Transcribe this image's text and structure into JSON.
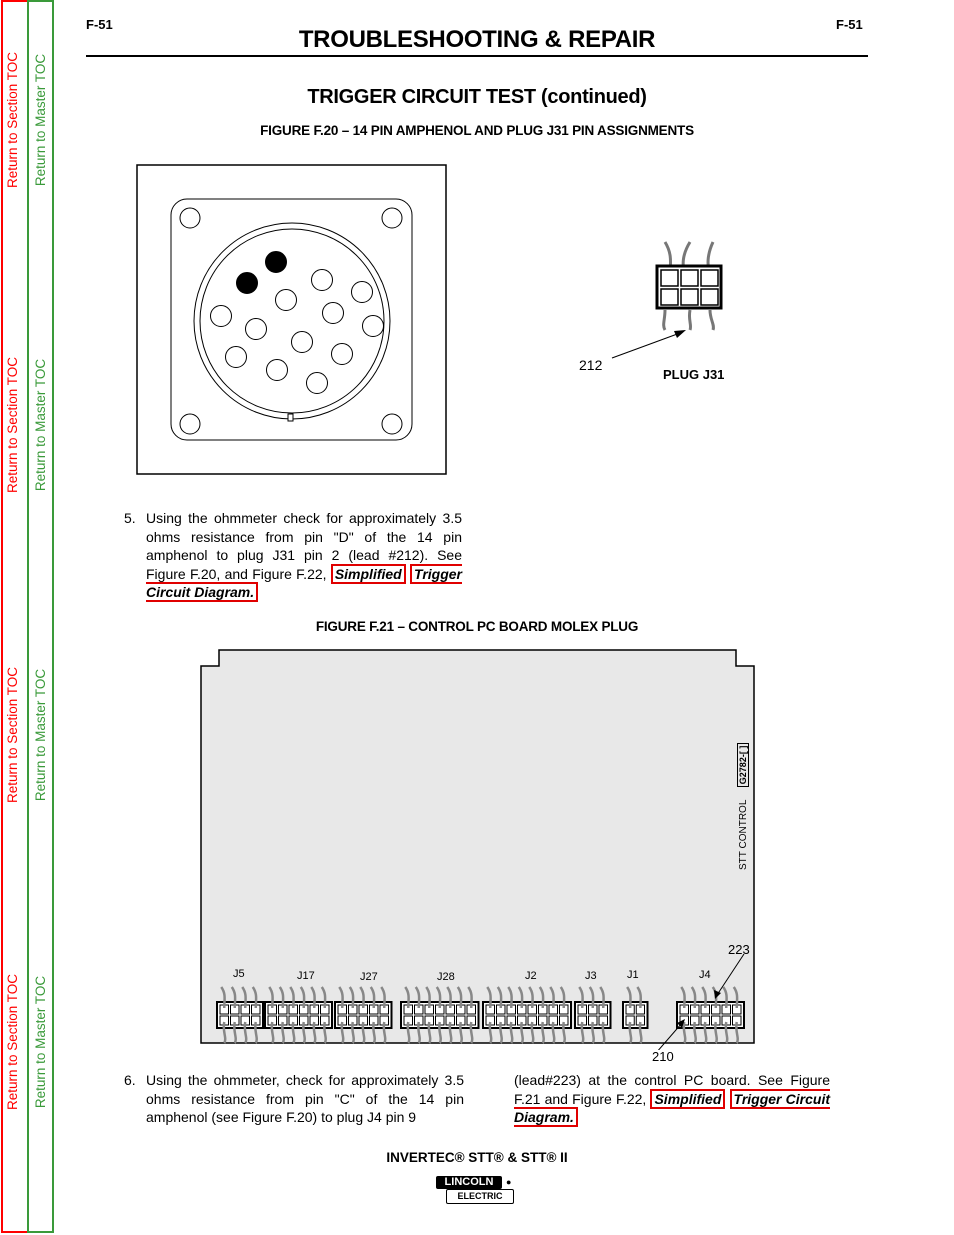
{
  "nav": {
    "section_toc": "Return to Section TOC",
    "master_toc": "Return to Master TOC",
    "colors": {
      "section": "#ff0000",
      "master": "#3a9a3a"
    }
  },
  "header": {
    "page_left": "F-51",
    "page_right": "F-51",
    "title": "TROUBLESHOOTING & REPAIR"
  },
  "section_title": "TRIGGER CIRCUIT TEST (continued)",
  "figure20": {
    "caption": "FIGURE F.20 – 14 PIN AMPHENOL AND PLUG J31 PIN ASSIGNMENTS",
    "amphenol_pins": 14,
    "highlighted_pins": [
      "D",
      "C"
    ],
    "lead_label": "212",
    "plug_label": "PLUG J31"
  },
  "step5": {
    "number": "5.",
    "text": "Using the ohmmeter check for approximately 3.5 ohms resistance from pin \"D\" of the 14 pin amphenol to plug J31 pin 2 (lead #212).  See Figure F.20, and Figure F.22,",
    "link_part1": "Simplified",
    "link_part2": "Trigger Circuit Diagram."
  },
  "figure21": {
    "caption": "FIGURE F.21 – CONTROL PC BOARD MOLEX PLUG",
    "board_label": "STT CONTROL",
    "board_part": "G2782-[ ]",
    "connectors": [
      "J5",
      "J17",
      "J27",
      "J28",
      "J2",
      "J3",
      "J1",
      "J4"
    ],
    "lead_top": "223",
    "lead_bottom": "210"
  },
  "step6": {
    "number": "6.",
    "text_col1": "Using the ohmmeter, check for approximately 3.5 ohms resistance from pin \"C\" of the 14 pin amphenol (see Figure F.20) to plug J4 pin 9",
    "text_col2": "(lead#223) at the control PC board.  See Figure F.21 and Figure F.22,",
    "link_part1": "Simplified",
    "link_part2": "Trigger Circuit Diagram."
  },
  "footer": {
    "product": "INVERTEC® STT® & STT® II",
    "logo_top": "LINCOLN",
    "logo_bottom": "ELECTRIC"
  }
}
